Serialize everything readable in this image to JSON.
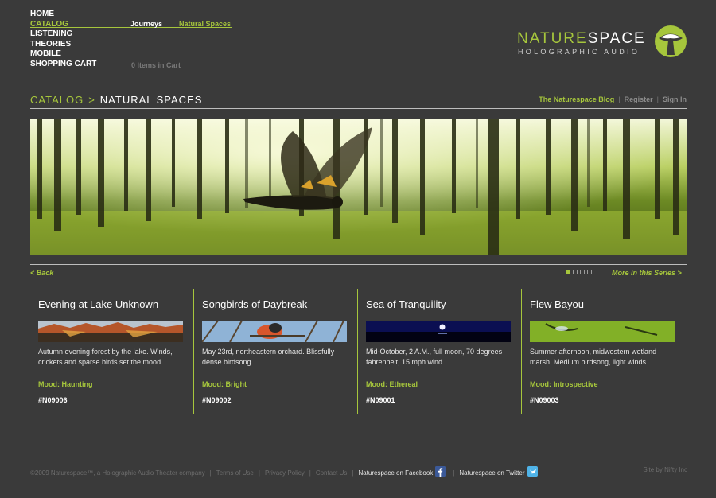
{
  "nav": {
    "items": [
      "HOME",
      "CATALOG",
      "LISTENING",
      "THEORIES",
      "MOBILE",
      "SHOPPING CART"
    ],
    "sub": [
      "Journeys",
      "Natural Spaces"
    ],
    "cart": "0 Items in Cart"
  },
  "logo": {
    "word1": "NATURE",
    "word2": "SPACE",
    "sub": "HOLOGRAPHIC AUDIO"
  },
  "breadcrumb": {
    "parent": "CATALOG",
    "sep": ">",
    "current": "NATURAL SPACES"
  },
  "toplinks": {
    "blog": "The Naturespace Blog",
    "register": "Register",
    "signin": "Sign In",
    "sep": "|"
  },
  "pager": {
    "back": "<  Back",
    "more": "More in this Series  >",
    "current": 1,
    "total": 4
  },
  "cards": [
    {
      "title": "Evening at Lake Unknown",
      "desc": "Autumn evening forest by the lake. Winds, crickets and sparse birds set the mood...",
      "mood": "Mood: Haunting",
      "code": "#N09006"
    },
    {
      "title": "Songbirds of Daybreak",
      "desc": "May 23rd, northeastern orchard. Blissfully dense birdsong....",
      "mood": "Mood: Bright",
      "code": "#N09002"
    },
    {
      "title": "Sea of Tranquility",
      "desc": "Mid-October, 2 A.M., full moon, 70 degrees fahrenheit, 15 mph wind...",
      "mood": "Mood: Ethereal",
      "code": "#N09001"
    },
    {
      "title": "Flew Bayou",
      "desc": "Summer afternoon, midwestern wetland marsh. Medium birdsong, light winds...",
      "mood": "Mood: Introspective",
      "code": "#N09003"
    }
  ],
  "footer": {
    "copyright": "©2009 Naturespace™, a Holographic Audio Theater company",
    "terms": "Terms of Use",
    "privacy": "Privacy Policy",
    "contact": "Contact Us",
    "facebook": "Naturespace on Facebook",
    "twitter": "Naturespace on Twitter",
    "sep": "|",
    "credit": "Site by Nifty Inc"
  },
  "colors": {
    "accent": "#a6c63c",
    "background": "#3a3a3a"
  },
  "icons": {
    "facebook": "facebook-icon",
    "twitter": "twitter-icon",
    "logo": "tree-logo-icon"
  }
}
